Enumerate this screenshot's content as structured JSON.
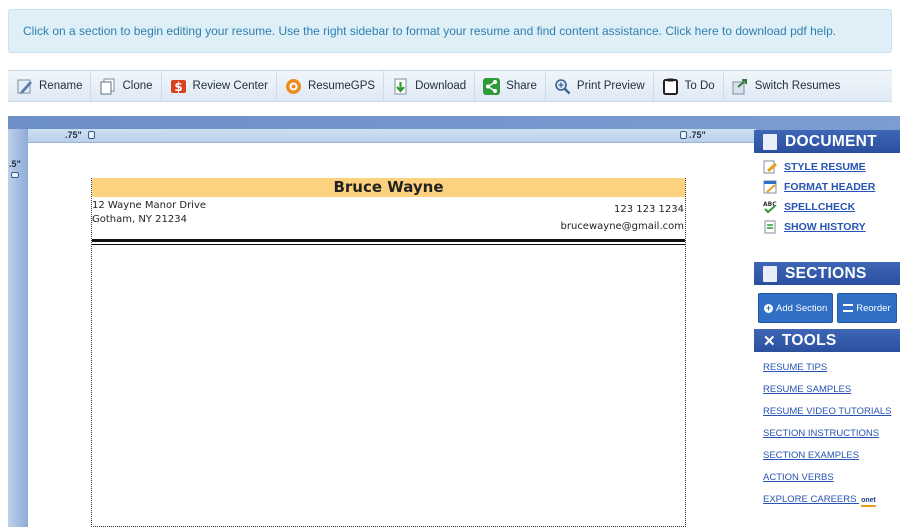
{
  "banner": {
    "text": "Click on a section to begin editing your resume. Use the right sidebar to format your resume and find content assistance. Click here to download pdf help."
  },
  "toolbar": {
    "buttons": [
      {
        "label": "Rename",
        "icon": "pencil-icon"
      },
      {
        "label": "Clone",
        "icon": "clone-icon"
      },
      {
        "label": "Review Center",
        "icon": "review-icon"
      },
      {
        "label": "ResumeGPS",
        "icon": "gps-icon"
      },
      {
        "label": "Download",
        "icon": "download-icon"
      },
      {
        "label": "Share",
        "icon": "share-icon"
      },
      {
        "label": "Print Preview",
        "icon": "magnifier-icon"
      },
      {
        "label": "To Do",
        "icon": "clipboard-icon"
      },
      {
        "label": "Switch Resumes",
        "icon": "switch-icon"
      }
    ]
  },
  "ruler": {
    "left_margin": ".75\"",
    "right_margin": ".75\"",
    "top_margin": ".5\""
  },
  "resume": {
    "name": "Bruce Wayne",
    "address_line1": "12 Wayne Manor Drive",
    "address_line2": "Gotham, NY 21234",
    "phone": "123 123 1234",
    "email": "brucewayne@gmail.com"
  },
  "sidebar": {
    "document": {
      "title": "DOCUMENT",
      "links": [
        "STYLE RESUME",
        "FORMAT HEADER",
        "SPELLCHECK",
        "SHOW HISTORY"
      ]
    },
    "sections": {
      "title": "SECTIONS",
      "add_label": "Add Section",
      "reorder_label": "Reorder"
    },
    "tools": {
      "title": "TOOLS",
      "links": [
        "RESUME TIPS",
        "RESUME SAMPLES",
        "RESUME VIDEO TUTORIALS",
        "SECTION INSTRUCTIONS",
        "SECTION EXAMPLES",
        "ACTION VERBS",
        "EXPLORE CAREERS"
      ],
      "onet_badge": "onet"
    }
  },
  "colors": {
    "accent": "#2a4f9e",
    "banner_text": "#2f7fb0",
    "header_fill": "#fdd27f",
    "workspace": "#7c9dd1"
  }
}
